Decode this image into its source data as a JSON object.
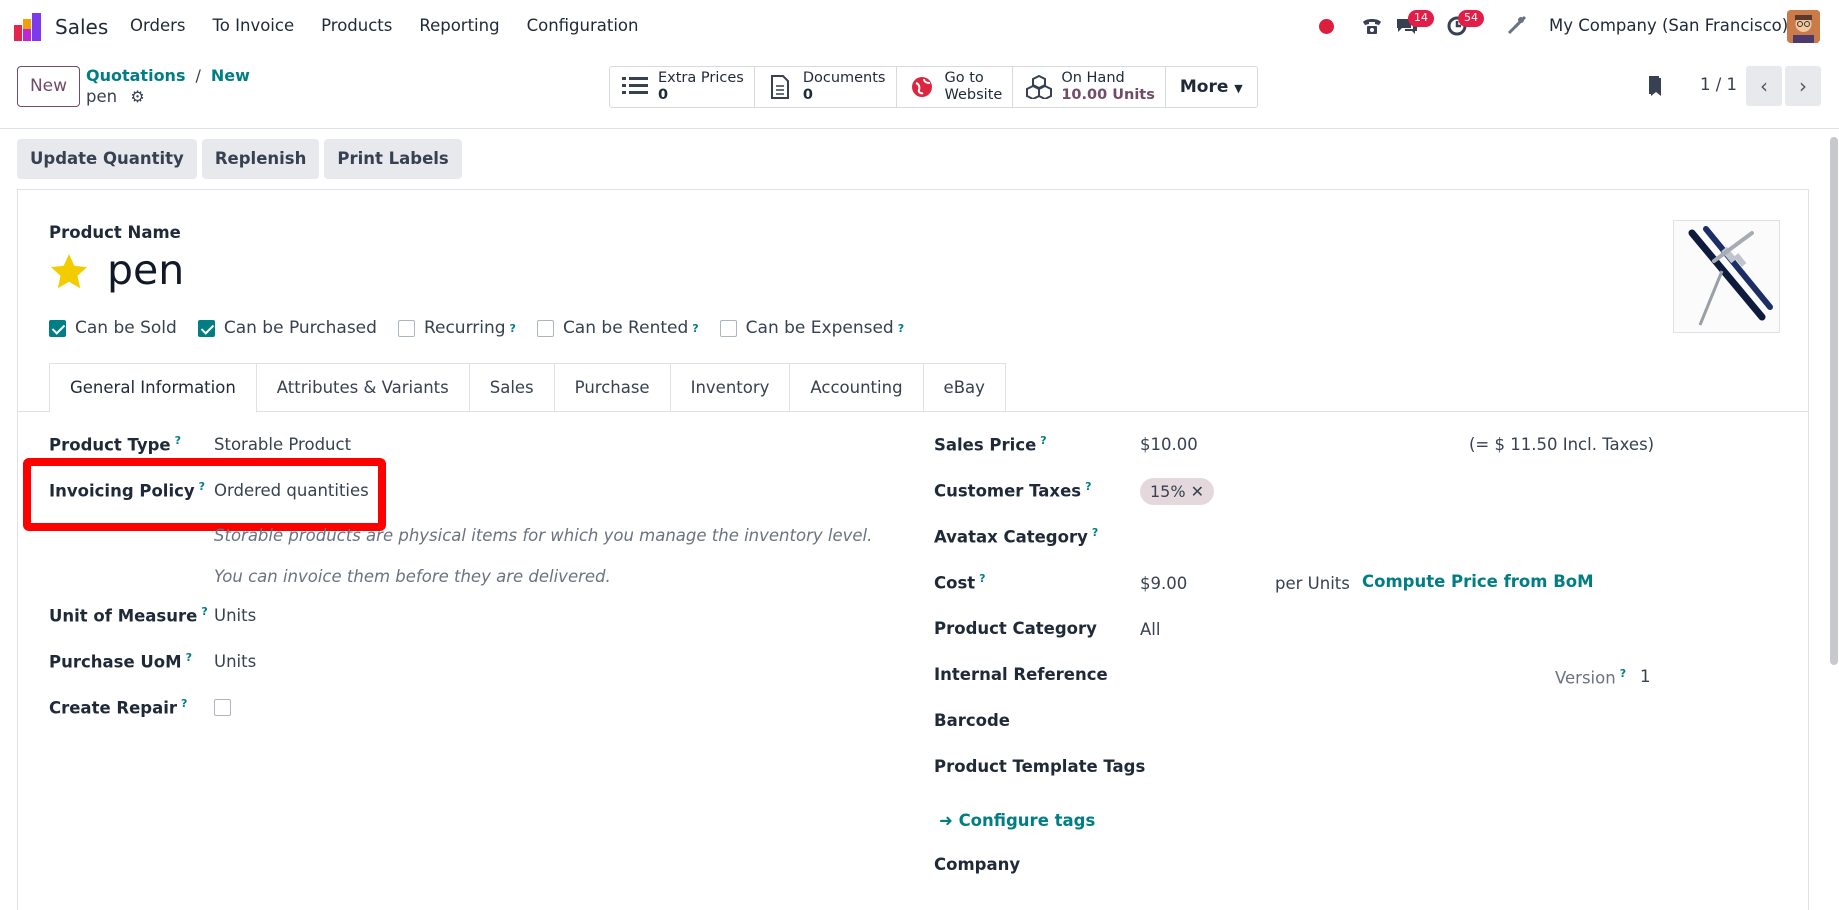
{
  "navbar": {
    "app_name": "Sales",
    "menu": [
      "Orders",
      "To Invoice",
      "Products",
      "Reporting",
      "Configuration"
    ],
    "messages_count": "14",
    "activities_count": "54",
    "company": "My Company (San Francisco)"
  },
  "control": {
    "new_label": "New",
    "breadcrumb_parent": "Quotations",
    "breadcrumb_sep": "/",
    "breadcrumb_current": "New",
    "record_name": "pen",
    "smart_buttons": [
      {
        "icon": "list-icon",
        "line1": "Extra Prices",
        "line2": "0"
      },
      {
        "icon": "document-icon",
        "line1": "Documents",
        "line2": "0"
      },
      {
        "icon": "globe-icon",
        "line1": "Go to",
        "line2": "Website"
      },
      {
        "icon": "cubes-icon",
        "line1": "On Hand",
        "line2": "10.00 Units"
      }
    ],
    "more_label": "More",
    "pager": "1 / 1"
  },
  "actions": [
    "Update Quantity",
    "Replenish",
    "Print Labels"
  ],
  "form": {
    "product_name_label": "Product Name",
    "product_name": "pen",
    "checkboxes": [
      {
        "label": "Can be Sold",
        "checked": true,
        "help": false
      },
      {
        "label": "Can be Purchased",
        "checked": true,
        "help": false
      },
      {
        "label": "Recurring",
        "checked": false,
        "help": true
      },
      {
        "label": "Can be Rented",
        "checked": false,
        "help": true
      },
      {
        "label": "Can be Expensed",
        "checked": false,
        "help": true
      }
    ],
    "tabs": [
      "General Information",
      "Attributes & Variants",
      "Sales",
      "Purchase",
      "Inventory",
      "Accounting",
      "eBay"
    ],
    "active_tab": "General Information",
    "left": {
      "product_type_label": "Product Type",
      "product_type": "Storable Product",
      "invoicing_policy_label": "Invoicing Policy",
      "invoicing_policy": "Ordered quantities",
      "help1": "Storable products are physical items for which you manage the inventory level.",
      "help2": "You can invoice them before they are delivered.",
      "uom_label": "Unit of Measure",
      "uom": "Units",
      "purchase_uom_label": "Purchase UoM",
      "purchase_uom": "Units",
      "create_repair_label": "Create Repair"
    },
    "right": {
      "sales_price_label": "Sales Price",
      "sales_price": "$10.00",
      "incl_taxes": "(= $ 11.50 Incl. Taxes)",
      "customer_taxes_label": "Customer Taxes",
      "tax_tag": "15%",
      "avatax_label": "Avatax Category",
      "cost_label": "Cost",
      "cost": "$9.00",
      "per_units": "per Units",
      "compute_bom": "Compute Price from BoM",
      "product_category_label": "Product Category",
      "product_category": "All",
      "internal_ref_label": "Internal Reference",
      "version_label": "Version",
      "version": "1",
      "barcode_label": "Barcode",
      "tags_label": "Product Template Tags",
      "configure_tags": "Configure tags",
      "company_label": "Company"
    }
  },
  "colors": {
    "brand": "#714b67",
    "link": "#017e84",
    "badge": "#e11d48",
    "highlight": "#ff0000",
    "star": "#f3cc00"
  }
}
